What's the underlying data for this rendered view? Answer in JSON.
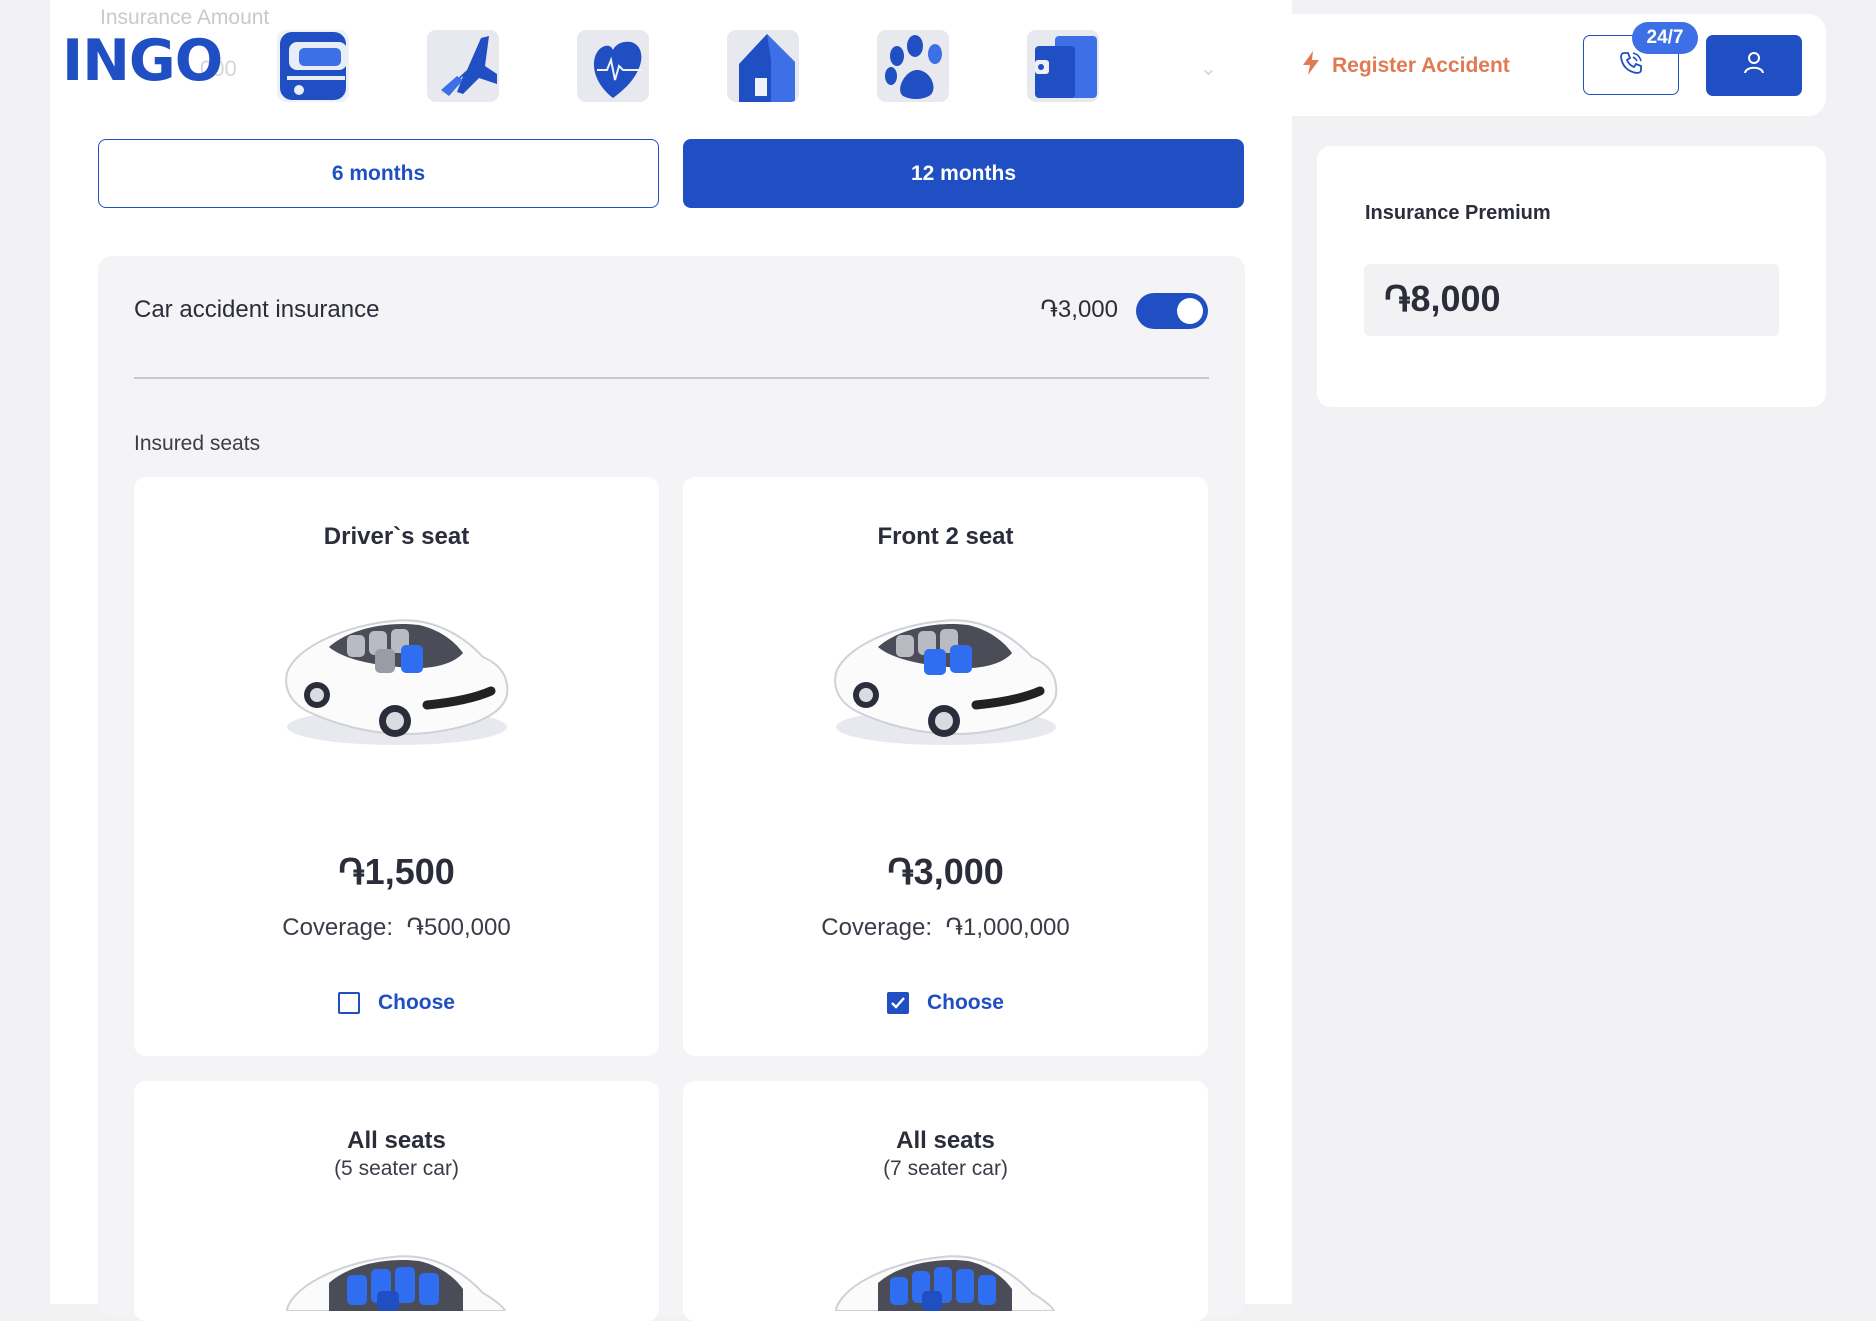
{
  "background_form": {
    "label": "Insurance Amount",
    "value": "000"
  },
  "header": {
    "logo": "INGO",
    "categories": [
      {
        "name": "car",
        "icon": "car-icon"
      },
      {
        "name": "travel",
        "icon": "airplane-icon"
      },
      {
        "name": "health",
        "icon": "heart-pulse-icon"
      },
      {
        "name": "property",
        "icon": "house-icon"
      },
      {
        "name": "pet",
        "icon": "paw-icon"
      },
      {
        "name": "finance",
        "icon": "wallet-icon"
      }
    ],
    "register_accident": "Register Accident",
    "support_badge": "24/7",
    "accent_color": "#1f4fc3",
    "register_color": "#df7a53"
  },
  "period": {
    "options": [
      "6 months",
      "12 months"
    ],
    "selected": "12 months"
  },
  "insurance": {
    "title": "Car accident insurance",
    "price": "֏3,000",
    "enabled": true,
    "seats_label": "Insured seats"
  },
  "seat_options": [
    {
      "title": "Driver`s seat",
      "subtitle": "",
      "price": "֏1,500",
      "coverage_label": "Coverage:",
      "coverage": "֏500,000",
      "choose": "Choose",
      "checked": false
    },
    {
      "title": "Front 2 seat",
      "subtitle": "",
      "price": "֏3,000",
      "coverage_label": "Coverage:",
      "coverage": "֏1,000,000",
      "choose": "Choose",
      "checked": true
    },
    {
      "title": "All seats",
      "subtitle": "(5 seater car)"
    },
    {
      "title": "All seats",
      "subtitle": "(7 seater car)"
    }
  ],
  "premium": {
    "title": "Insurance Premium",
    "amount": "֏8,000"
  }
}
